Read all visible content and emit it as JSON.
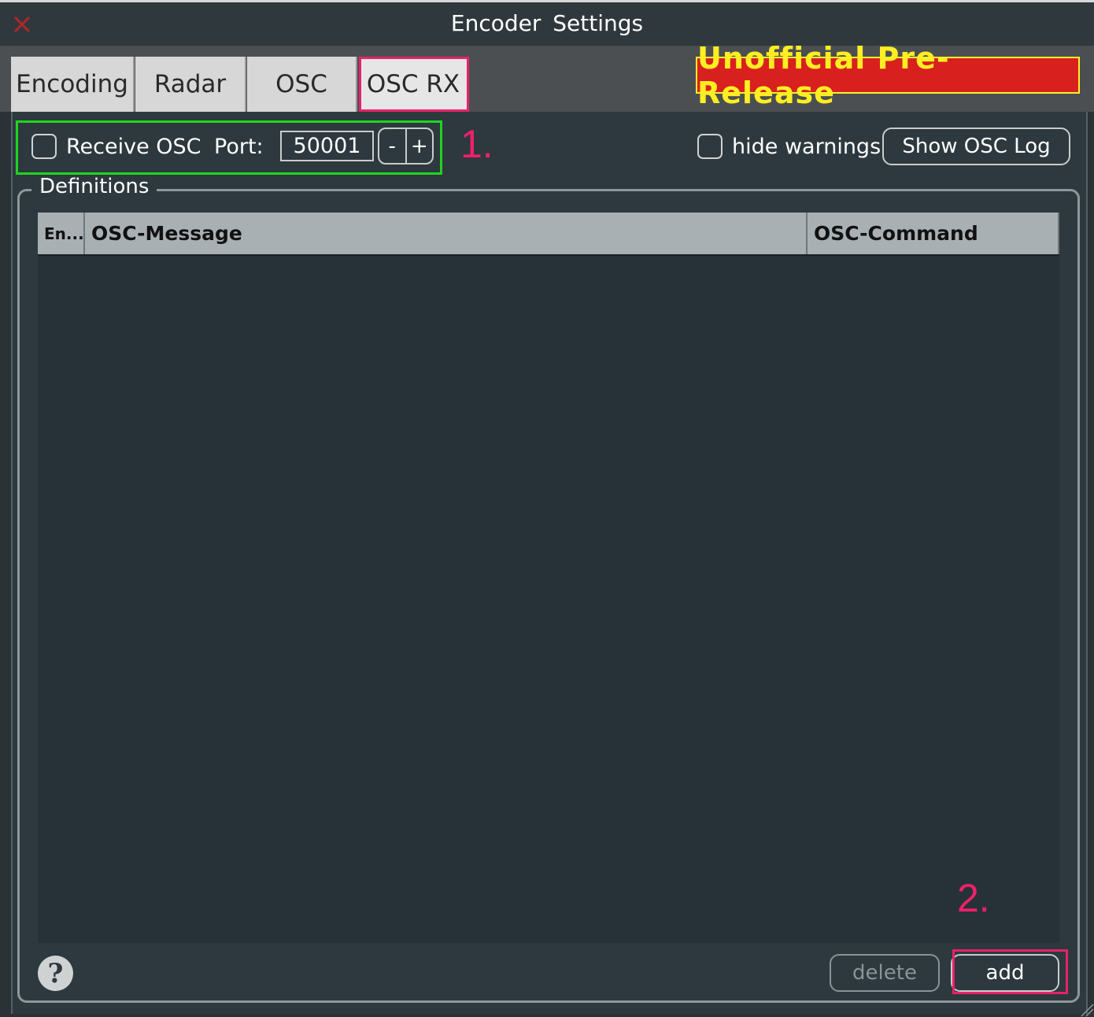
{
  "window": {
    "title": "Encoder  Settings"
  },
  "tabs": [
    {
      "label": "Encoding"
    },
    {
      "label": "Radar"
    },
    {
      "label": "OSC"
    },
    {
      "label": "OSC RX"
    }
  ],
  "badge": {
    "text": "Unofficial Pre-Release"
  },
  "osc_receive": {
    "checkbox_label": "Receive OSC",
    "checked": false,
    "port_label": "Port:",
    "port_value": "50001",
    "decrement_label": "-",
    "increment_label": "+"
  },
  "annotations": {
    "step1": "1.",
    "step2": "2."
  },
  "options": {
    "hide_warnings_label": "hide warnings",
    "hide_warnings_checked": false,
    "show_log_label": "Show OSC Log"
  },
  "definitions": {
    "group_label": "Definitions",
    "columns": [
      "En...",
      "OSC-Message",
      "OSC-Command"
    ],
    "rows": []
  },
  "footer": {
    "delete_label": "delete",
    "add_label": "add",
    "help_label": "?"
  },
  "colors": {
    "accent_annotation": "#f0206a",
    "highlight_green": "#20d420",
    "badge_bg": "#d8211f",
    "badge_text": "#ffee22",
    "close_icon": "#b0262a"
  }
}
